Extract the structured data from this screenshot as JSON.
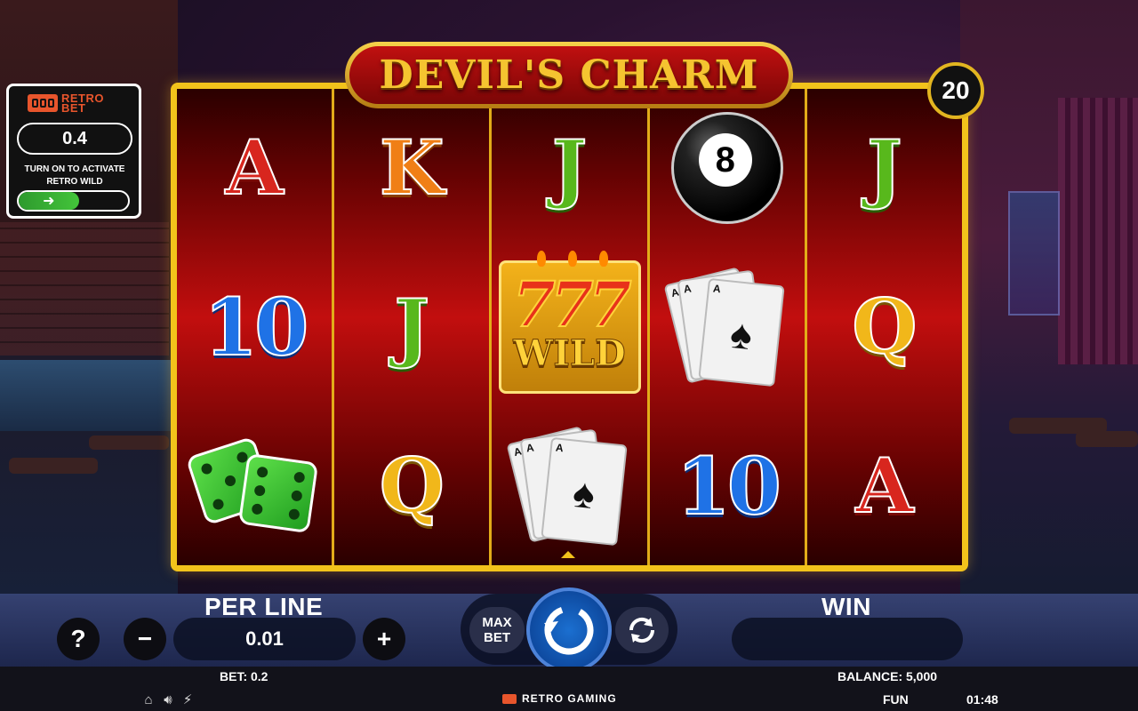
{
  "game": {
    "title": "DEVIL'S CHARM",
    "lines": "20"
  },
  "retro_bet": {
    "logo_line1": "RETRO",
    "logo_line2": "BET",
    "value": "0.4",
    "description": "TURN ON TO ACTIVATE RETRO WILD",
    "toggle_state": "off"
  },
  "reels": [
    [
      "A",
      "10",
      "dice"
    ],
    [
      "K",
      "J",
      "Q"
    ],
    [
      "J",
      "777 WILD",
      "cards"
    ],
    [
      "8-ball",
      "cards",
      "10"
    ],
    [
      "J",
      "Q",
      "A"
    ]
  ],
  "symbols": {
    "eight_ball_label": "8",
    "wild_top": "777",
    "wild_label": "WILD",
    "card_corner": "A"
  },
  "controls": {
    "help_label": "?",
    "minus_label": "−",
    "plus_label": "+",
    "per_line_label": "PER LINE",
    "per_line_value": "0.01",
    "max_bet_label": "MAX BET",
    "win_label": "WIN",
    "win_value": ""
  },
  "status": {
    "bet": "BET: 0.2",
    "balance": "BALANCE: 5,000",
    "mode": "FUN",
    "time": "01:48",
    "brand": "RETRO GAMING"
  },
  "colors": {
    "frame_gold": "#f2c31b",
    "reel_red": "#c20e0e",
    "spin_blue": "#1b6fd0",
    "brand_orange": "#e8552c"
  }
}
